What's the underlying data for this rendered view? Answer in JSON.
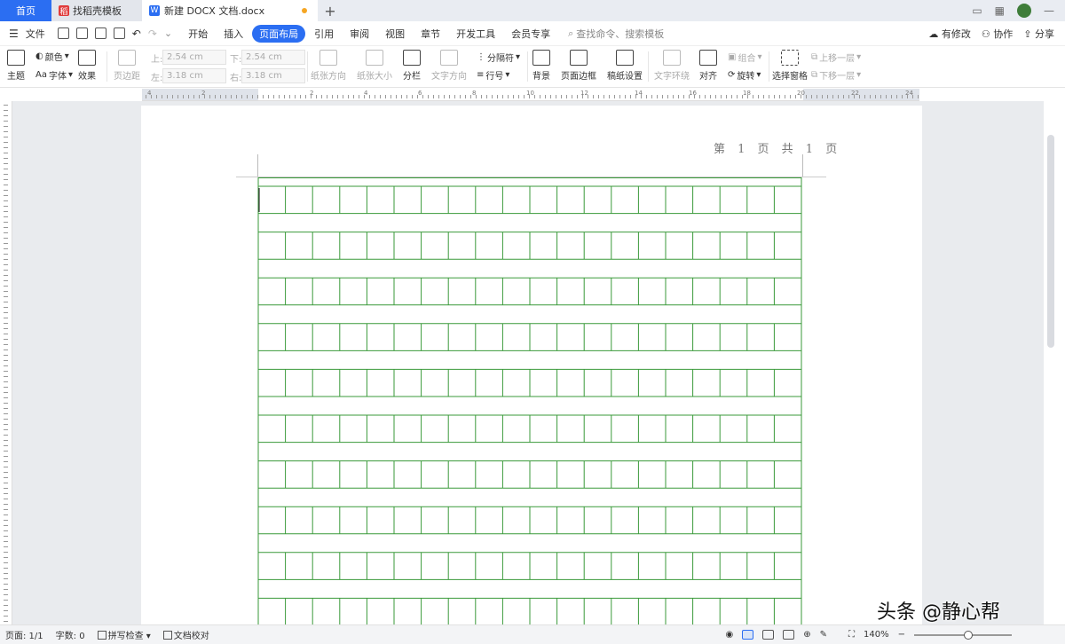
{
  "tabs": {
    "home": "首页",
    "template": "找稻壳模板",
    "document": "新建 DOCX 文档.docx"
  },
  "menu": {
    "file": "文件",
    "items": [
      "开始",
      "插入",
      "页面布局",
      "引用",
      "审阅",
      "视图",
      "章节",
      "开发工具",
      "会员专享"
    ],
    "active": "页面布局",
    "search_placeholder": "查找命令、搜索模板",
    "right": {
      "modified": "有修改",
      "collab": "协作",
      "share": "分享"
    }
  },
  "ribbon": {
    "theme": "主题",
    "color": "颜色",
    "font": "字体",
    "effects": "效果",
    "margins": "页边距",
    "top_label": "上:",
    "top_value": "2.54 cm",
    "bottom_label": "下:",
    "bottom_value": "2.54 cm",
    "left_label": "左:",
    "left_value": "3.18 cm",
    "right_label": "右:",
    "right_value": "3.18 cm",
    "orientation": "纸张方向",
    "size": "纸张大小",
    "columns": "分栏",
    "text_direction": "文字方向",
    "breaks": "分隔符",
    "line_numbers": "行号",
    "background": "背景",
    "page_border": "页面边框",
    "manuscript": "稿纸设置",
    "wrap": "文字环绕",
    "align": "对齐",
    "rotate": "旋转",
    "group": "组合",
    "selection_pane": "选择窗格",
    "bring_forward": "上移一层",
    "send_backward": "下移一层"
  },
  "document": {
    "header": "第 1 页 共 1 页",
    "grid_color": "#3a9a3a",
    "grid_rows": 10,
    "grid_cols": 20
  },
  "status": {
    "page": "页面: 1/1",
    "words": "字数: 0",
    "spell": "拼写检查",
    "proof": "文档校对",
    "zoom": "140%"
  },
  "watermark": "头条 @静心帮",
  "colors": {
    "accent": "#2b6ef2",
    "grid": "#3a9a3a"
  }
}
